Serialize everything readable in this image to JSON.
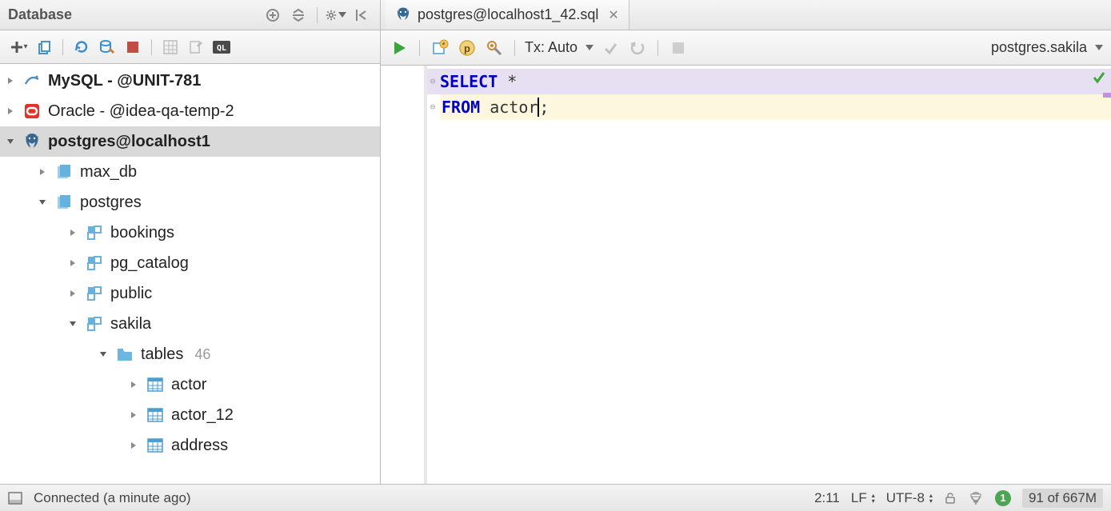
{
  "panel_title": "Database",
  "tab": {
    "label": "postgres@localhost1_42.sql"
  },
  "editor_toolbar": {
    "tx_label": "Tx: Auto",
    "schema_selector": "postgres.sakila"
  },
  "sql": {
    "line1_kw": "SELECT",
    "line1_rest": " *",
    "line2_kw": "FROM",
    "line2_rest": " actor",
    "line2_tail": ";"
  },
  "tree": {
    "mysql": "MySQL - @UNIT-781",
    "oracle": "Oracle - @idea-qa-temp-2",
    "pg_conn": "postgres@localhost1",
    "db_max": "max_db",
    "db_pg": "postgres",
    "schema_bookings": "bookings",
    "schema_pgcat": "pg_catalog",
    "schema_public": "public",
    "schema_sakila": "sakila",
    "tables_label": "tables",
    "tables_count": "46",
    "tbl_actor": "actor",
    "tbl_actor12": "actor_12",
    "tbl_address": "address"
  },
  "status": {
    "conn": "Connected (a minute ago)",
    "pos": "2:11",
    "le": "LF",
    "enc": "UTF-8",
    "badge": "1",
    "mem": "91 of 667M"
  }
}
